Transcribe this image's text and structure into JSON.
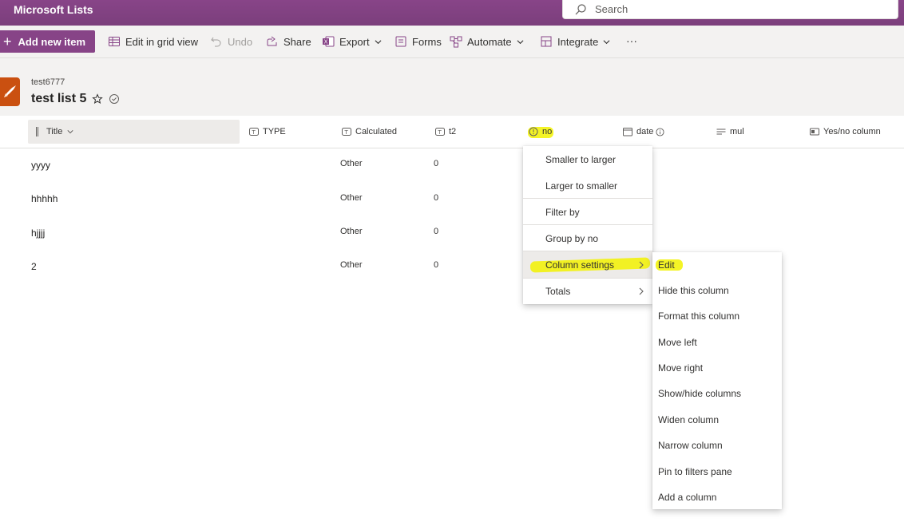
{
  "app": {
    "title": "Microsoft Lists"
  },
  "search": {
    "placeholder": "Search"
  },
  "command_bar": {
    "add_new_item": "Add new item",
    "edit_grid": "Edit in grid view",
    "undo": "Undo",
    "share": "Share",
    "export": "Export",
    "forms": "Forms",
    "automate": "Automate",
    "integrate": "Integrate",
    "more": "···"
  },
  "list": {
    "site": "test6777",
    "title": "test list 5"
  },
  "columns": {
    "title": "Title",
    "type": "TYPE",
    "calculated": "Calculated",
    "t2": "t2",
    "no": "no",
    "date": "date",
    "mul": "mul",
    "yes_no": "Yes/no column"
  },
  "rows": [
    {
      "title": "yyyy",
      "calculated": "Other",
      "t2": "0"
    },
    {
      "title": "hhhhh",
      "calculated": "Other",
      "t2": "0"
    },
    {
      "title": "hjjjj",
      "calculated": "Other",
      "t2": "0"
    },
    {
      "title": "2",
      "calculated": "Other",
      "t2": "0"
    }
  ],
  "column_menu": {
    "items": [
      "Smaller to larger",
      "Larger to smaller",
      "Filter by",
      "Group by no",
      "Column settings",
      "Totals"
    ]
  },
  "settings_submenu": {
    "items": [
      "Edit",
      "Hide this column",
      "Format this column",
      "Move left",
      "Move right",
      "Show/hide columns",
      "Widen column",
      "Narrow column",
      "Pin to filters pane",
      "Add a column"
    ]
  },
  "colors": {
    "suite_bar": "#884488",
    "accent": "#874487",
    "highlight": "#f2f200",
    "list_icon": "#ca5010"
  }
}
